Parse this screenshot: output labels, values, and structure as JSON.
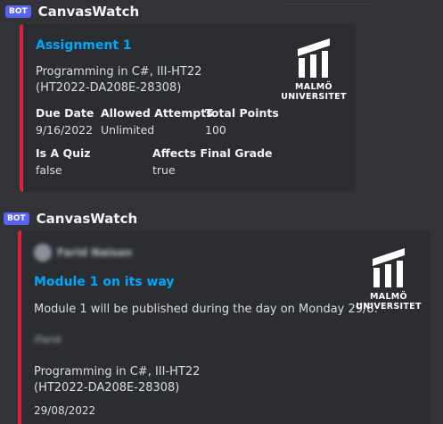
{
  "messages": [
    {
      "bot_tag": "BOT",
      "author": "CanvasWatch",
      "embed": {
        "title": "Assignment 1",
        "course_line1": "Programming in C#, III-HT22",
        "course_line2": "(HT2022-DA208E-28308)",
        "fields": {
          "due_date": {
            "name": "Due Date",
            "value": "9/16/2022"
          },
          "allowed_attempts": {
            "name": "Allowed Attempts",
            "value": "Unlimited"
          },
          "total_points": {
            "name": "Total Points",
            "value": "100"
          },
          "is_a_quiz": {
            "name": "Is A Quiz",
            "value": "false"
          },
          "affects_final_grade": {
            "name": "Affects Final Grade",
            "value": "true"
          }
        },
        "logo": {
          "line1": "MALMÖ",
          "line2": "UNIVERSITET"
        },
        "accent_color": "#e01f3d"
      }
    },
    {
      "bot_tag": "BOT",
      "author": "CanvasWatch",
      "embed": {
        "embed_author": "Farid Naisan",
        "title": "Module 1 on its way",
        "description": "Module 1 will be published during the day on Monday 29/8.",
        "signature": "/Farid",
        "course_line1": "Programming in C#, III-HT22",
        "course_line2": "(HT2022-DA208E-28308)",
        "date": "29/08/2022",
        "logo": {
          "line1": "MALMÖ",
          "line2": "UNIVERSITET"
        },
        "accent_color": "#e01f3d"
      }
    }
  ]
}
